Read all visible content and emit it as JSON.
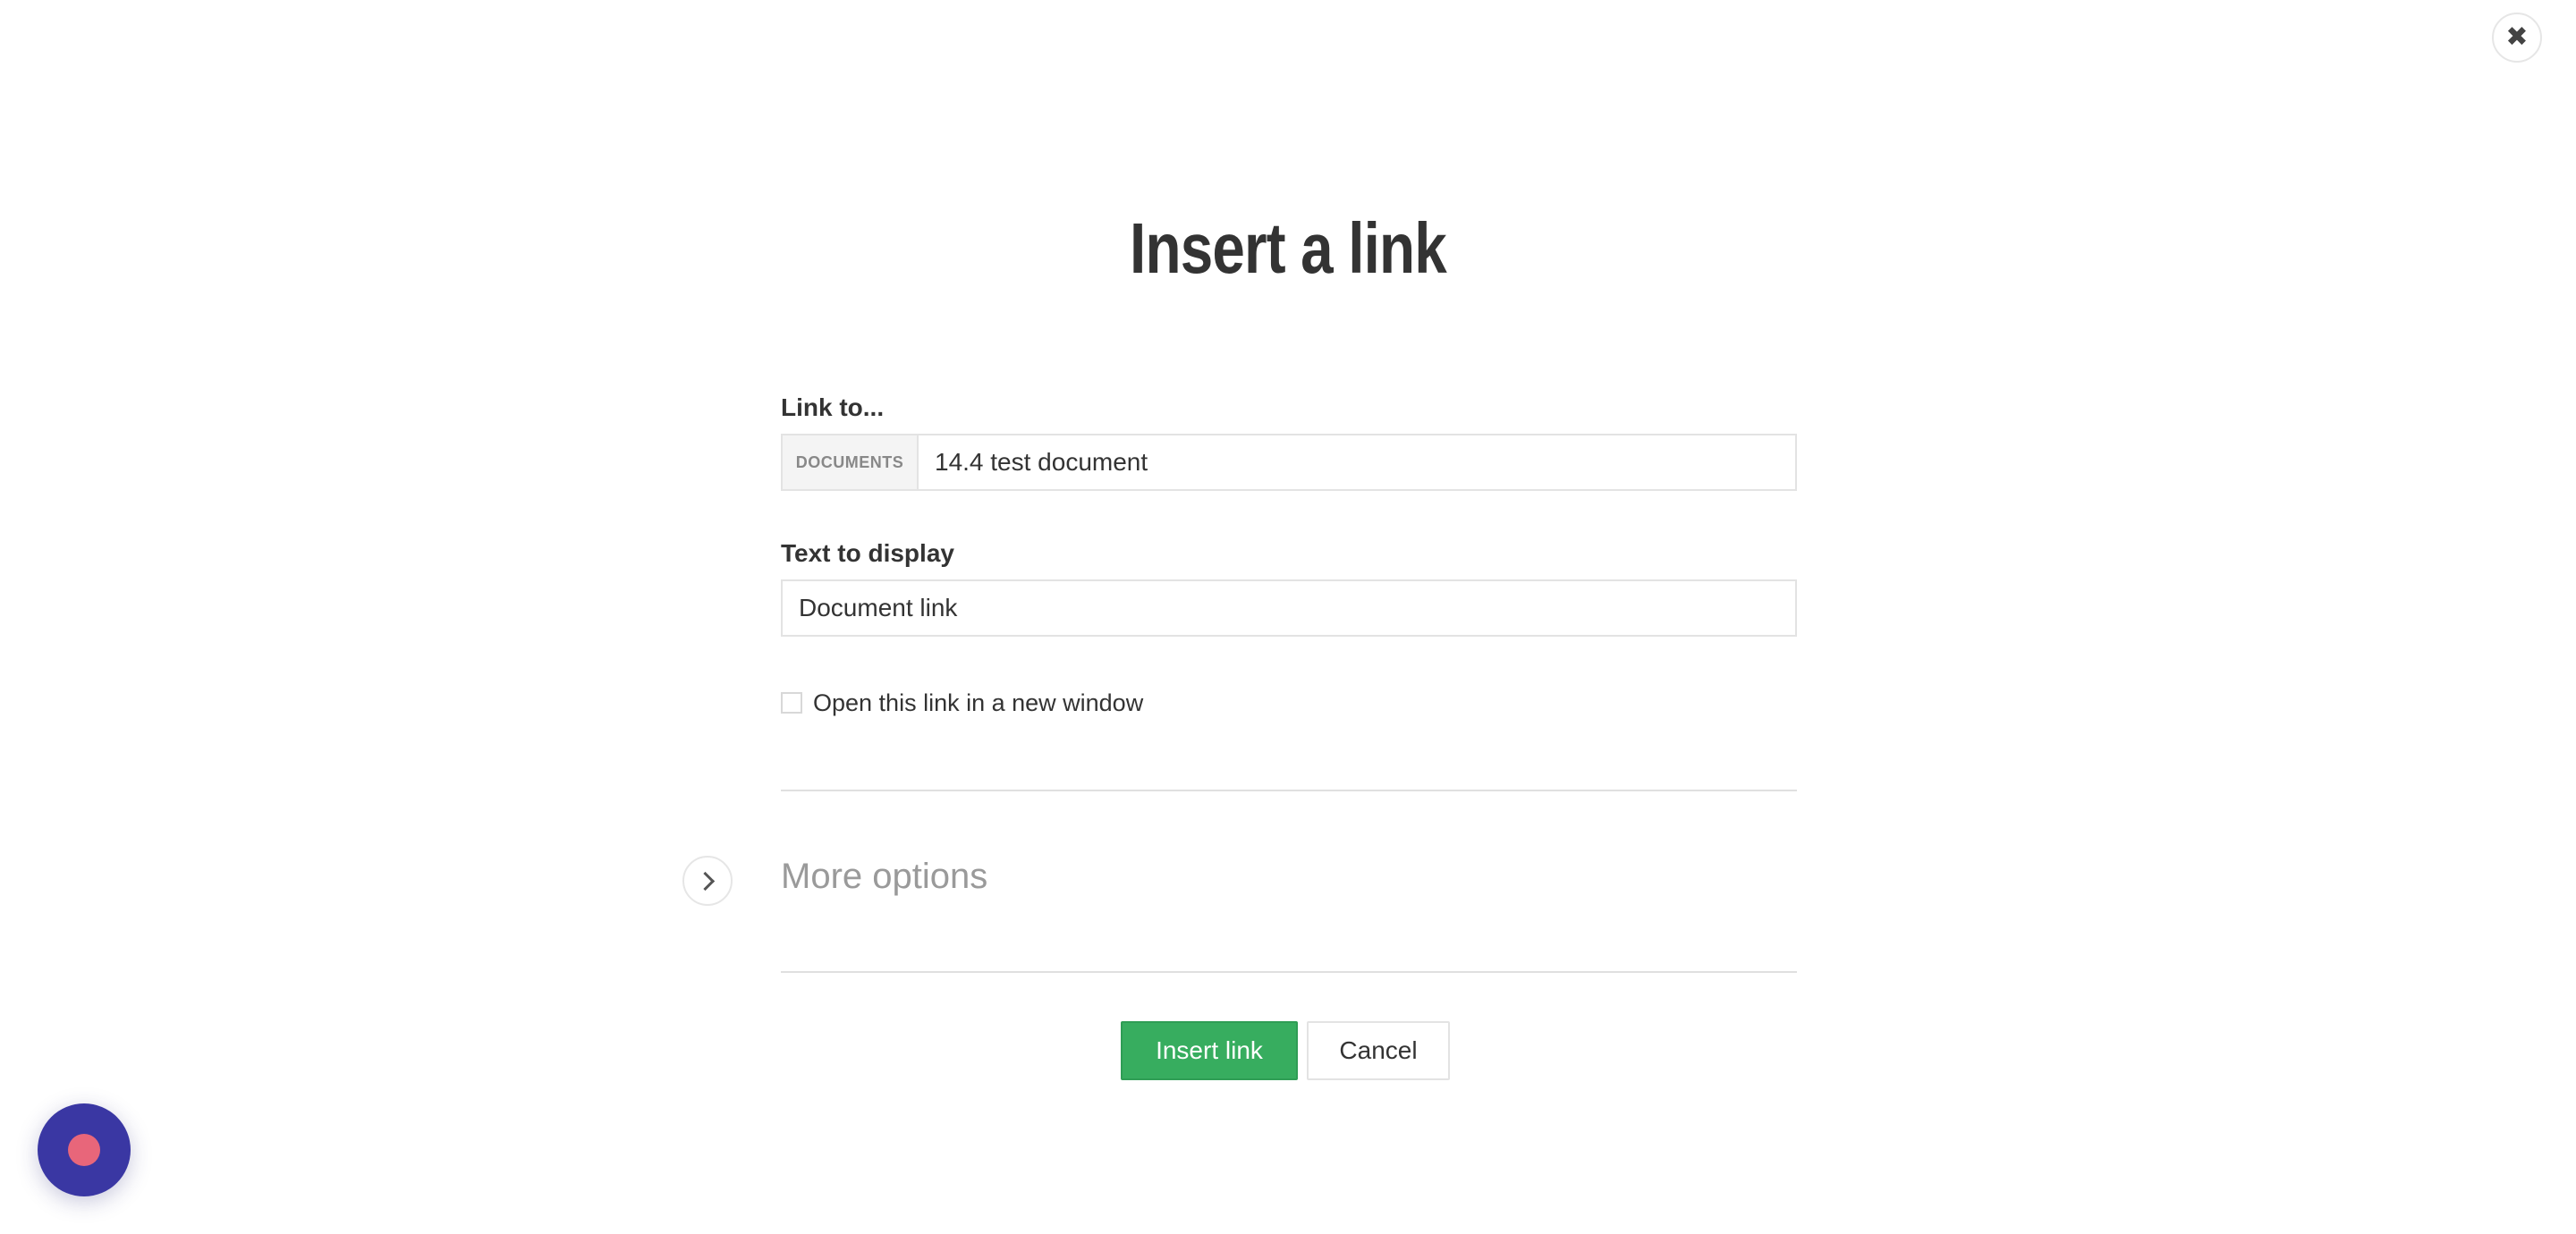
{
  "dialog": {
    "title": "Insert a link",
    "close_icon": "close-icon"
  },
  "link_to": {
    "label": "Link to...",
    "prefix": "DOCUMENTS",
    "value": "14.4 test document"
  },
  "text_to_display": {
    "label": "Text to display",
    "value": "Document link"
  },
  "new_window": {
    "label": "Open this link in a new window",
    "checked": false
  },
  "more_options": {
    "label": "More options",
    "icon": "chevron-right-icon"
  },
  "actions": {
    "insert_label": "Insert link",
    "cancel_label": "Cancel"
  },
  "record_widget": {
    "icon": "record-icon"
  },
  "colors": {
    "primary_green": "#37ad5f",
    "record_button": "#3a37a3",
    "record_dot": "#e8667a"
  }
}
